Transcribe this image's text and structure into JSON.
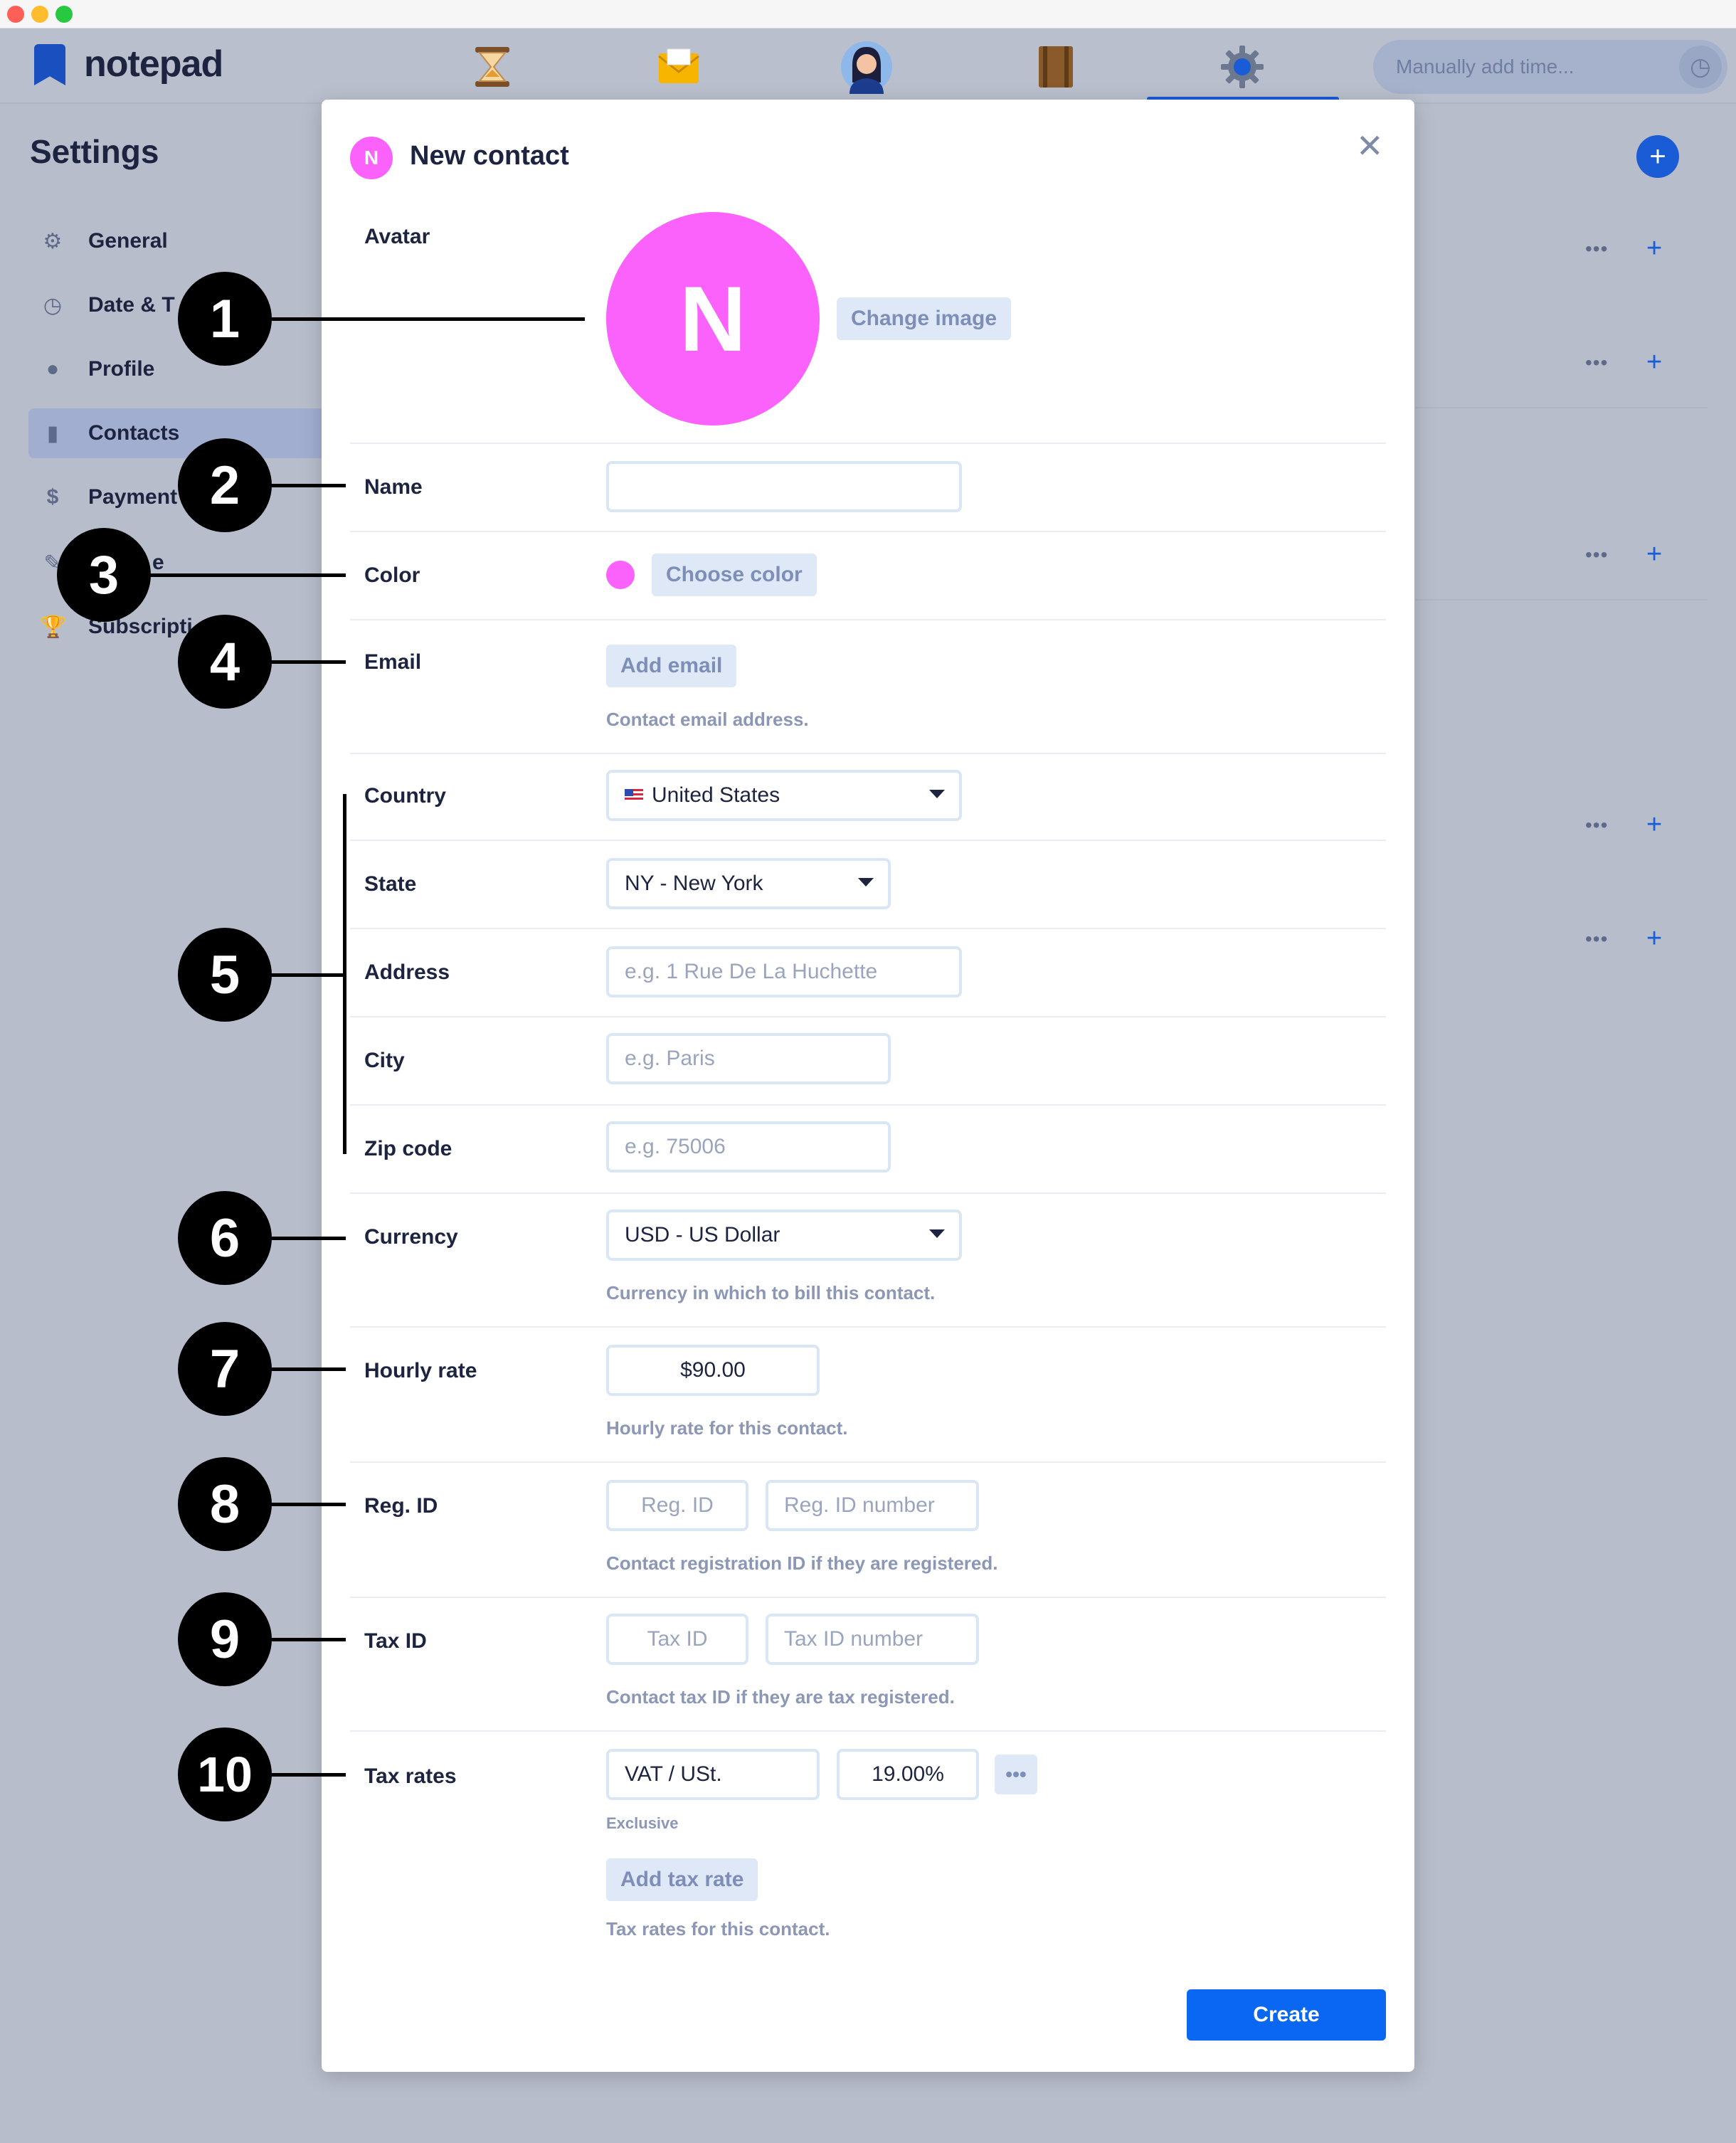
{
  "window": {
    "traffic_colors": [
      "#fe5f57",
      "#febc2e",
      "#28c840"
    ]
  },
  "app": {
    "name": "notepad",
    "nav": [
      {
        "name": "timer-icon",
        "glyph": "⌛"
      },
      {
        "name": "inbox-icon",
        "glyph": "✉"
      },
      {
        "name": "avatar-icon",
        "glyph": "👩"
      },
      {
        "name": "book-icon",
        "glyph": "📕"
      },
      {
        "name": "settings-icon",
        "glyph": "⚙"
      }
    ],
    "manual_time_placeholder": "Manually add time...",
    "accent": "#1a5bd6"
  },
  "settings": {
    "title": "Settings",
    "items": [
      {
        "label": "General",
        "icon": "gear-icon",
        "glyph": "⚙"
      },
      {
        "label": "Date & T",
        "icon": "clock-icon",
        "glyph": "◷"
      },
      {
        "label": "Profile",
        "icon": "person-icon",
        "glyph": "●"
      },
      {
        "label": "Contacts",
        "icon": "bookmark-icon",
        "glyph": "▮"
      },
      {
        "label": "Payment",
        "icon": "money-bag-icon",
        "glyph": "$"
      },
      {
        "label": "e",
        "icon": "pin-icon",
        "glyph": "✎"
      },
      {
        "label": "Subscripti",
        "icon": "trophy-icon",
        "glyph": "🏆"
      }
    ],
    "row_actions": {
      "dots": "•••",
      "plus": "+"
    }
  },
  "modal": {
    "badge": "N",
    "title": "New contact",
    "close": "✕",
    "avatar": {
      "label": "Avatar",
      "initial": "N",
      "change_label": "Change image",
      "color": "#fb61fb"
    },
    "name": {
      "label": "Name",
      "value": ""
    },
    "color": {
      "label": "Color",
      "choose_label": "Choose color"
    },
    "email": {
      "label": "Email",
      "add_label": "Add email",
      "help": "Contact email address."
    },
    "country": {
      "label": "Country",
      "value": "United States"
    },
    "state": {
      "label": "State",
      "value": "NY - New York"
    },
    "address": {
      "label": "Address",
      "placeholder": "e.g. 1 Rue De La Huchette"
    },
    "city": {
      "label": "City",
      "placeholder": "e.g. Paris"
    },
    "zip": {
      "label": "Zip code",
      "placeholder": "e.g. 75006"
    },
    "currency": {
      "label": "Currency",
      "value": "USD - US Dollar",
      "help": "Currency in which to bill this contact."
    },
    "hourly_rate": {
      "label": "Hourly rate",
      "value": "$90.00",
      "help": "Hourly rate for this contact."
    },
    "reg_id": {
      "label": "Reg. ID",
      "id_placeholder": "Reg. ID",
      "number_placeholder": "Reg. ID number",
      "help": "Contact registration ID if they are registered."
    },
    "tax_id": {
      "label": "Tax ID",
      "id_placeholder": "Tax ID",
      "number_placeholder": "Tax ID number",
      "help": "Contact tax ID if they are tax registered."
    },
    "tax_rates": {
      "label": "Tax rates",
      "name": "VAT / USt.",
      "rate": "19.00%",
      "more": "•••",
      "mode": "Exclusive",
      "add_label": "Add tax rate",
      "help": "Tax rates for this contact."
    },
    "create_label": "Create"
  },
  "callouts": [
    "1",
    "2",
    "3",
    "4",
    "5",
    "6",
    "7",
    "8",
    "9",
    "10"
  ]
}
